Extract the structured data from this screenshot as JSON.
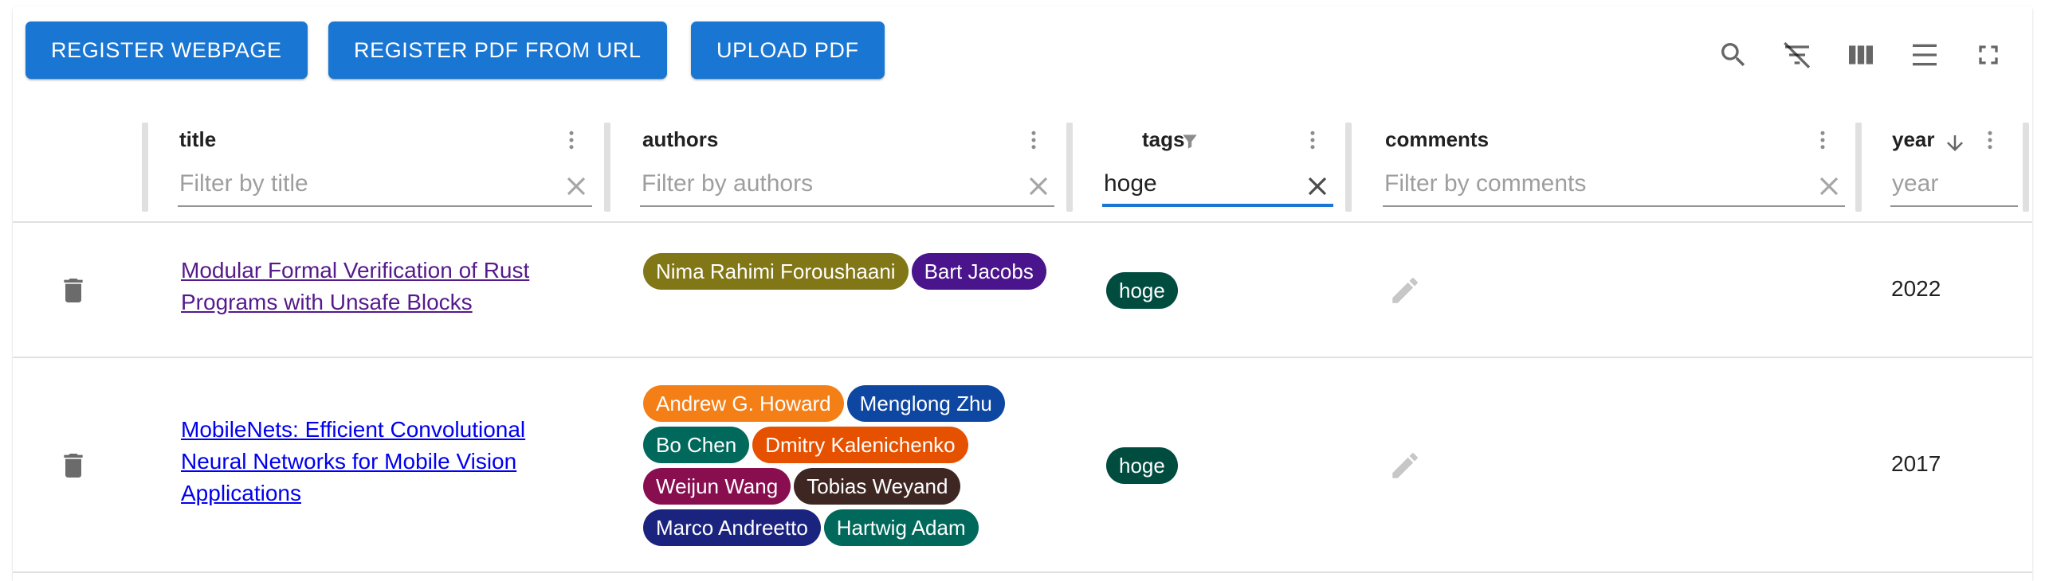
{
  "toolbar": {
    "register_webpage": "REGISTER WEBPAGE",
    "register_pdf_url": "REGISTER PDF FROM URL",
    "upload_pdf": "UPLOAD PDF"
  },
  "columns": {
    "title": {
      "label": "title",
      "placeholder": "Filter by title",
      "value": ""
    },
    "authors": {
      "label": "authors",
      "placeholder": "Filter by authors",
      "value": ""
    },
    "tags": {
      "label": "tags",
      "placeholder": "",
      "value": "hoge"
    },
    "comments": {
      "label": "comments",
      "placeholder": "Filter by comments",
      "value": ""
    },
    "year": {
      "label": "year",
      "placeholder": "year",
      "value": ""
    }
  },
  "rows": [
    {
      "title": "Modular Formal Verification of Rust Programs with Unsafe Blocks",
      "authors": [
        {
          "name": "Nima Rahimi Foroushaani",
          "color": "#827717"
        },
        {
          "name": "Bart Jacobs",
          "color": "#4a148c"
        }
      ],
      "tags": [
        {
          "name": "hoge",
          "color": "#004d40"
        }
      ],
      "year": "2022"
    },
    {
      "title": "MobileNets: Efficient Convolutional Neural Networks for Mobile Vision Applications",
      "authors": [
        {
          "name": "Andrew G. Howard",
          "color": "#f57f17"
        },
        {
          "name": "Menglong Zhu",
          "color": "#0d47a1"
        },
        {
          "name": "Bo Chen",
          "color": "#00695c"
        },
        {
          "name": "Dmitry Kalenichenko",
          "color": "#e65100"
        },
        {
          "name": "Weijun Wang",
          "color": "#880e4f"
        },
        {
          "name": "Tobias Weyand",
          "color": "#3e2723"
        },
        {
          "name": "Marco Andreetto",
          "color": "#1a237e"
        },
        {
          "name": "Hartwig Adam",
          "color": "#00695c"
        }
      ],
      "tags": [
        {
          "name": "hoge",
          "color": "#004d40"
        }
      ],
      "year": "2017"
    }
  ]
}
